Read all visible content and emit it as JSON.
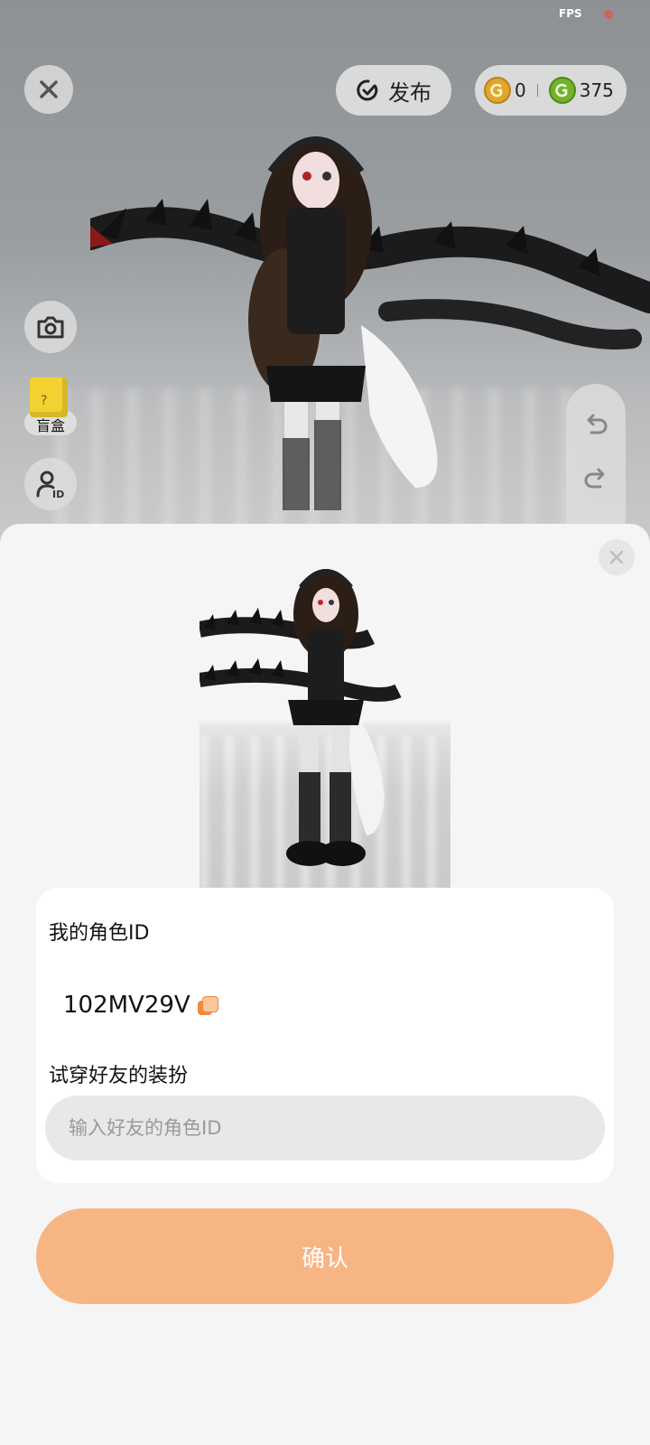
{
  "status": {
    "fps_label": "FPS"
  },
  "toolbar": {
    "publish_label": "发布",
    "currency": {
      "gold_amount": "0",
      "green_amount": "375"
    }
  },
  "side": {
    "blind_box_label": "盲盒"
  },
  "sheet": {
    "my_id_title": "我的角色ID",
    "my_id_value": "102MV29V",
    "try_title": "试穿好友的装扮",
    "input_placeholder": "输入好友的角色ID",
    "confirm_label": "确认"
  },
  "colors": {
    "accent": "#f7b584",
    "gold_coin": "#e0a82b",
    "green_coin": "#74b22c",
    "copy_icon": "#f08a3c"
  }
}
